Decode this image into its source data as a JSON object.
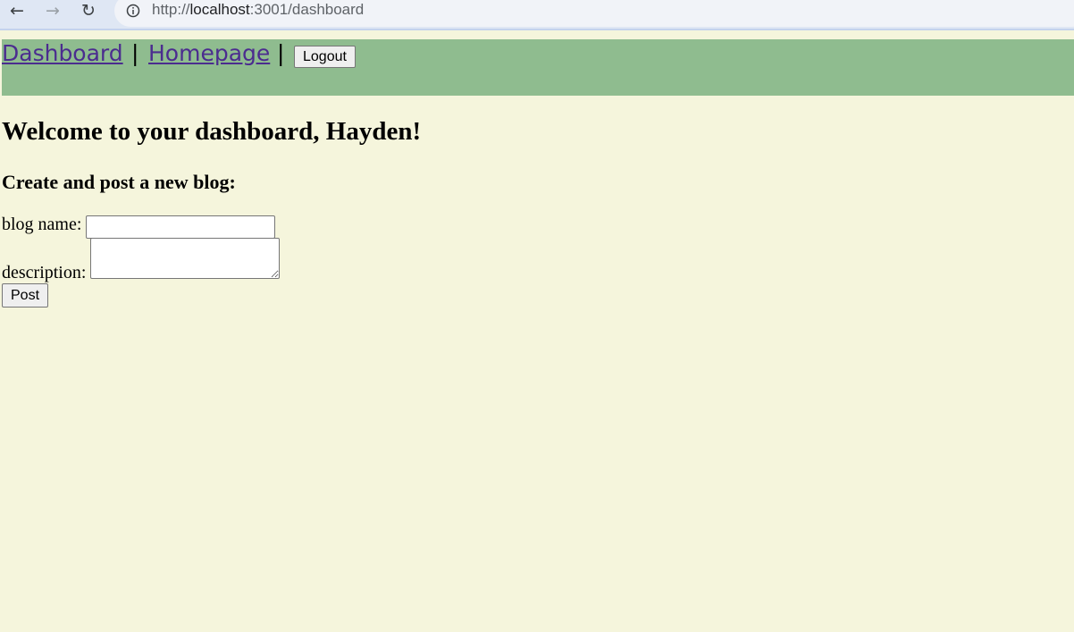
{
  "browser": {
    "url_scheme": "http://",
    "url_host": "localhost",
    "url_path": ":3001/dashboard",
    "icons": [
      "back-arrow-icon",
      "forward-arrow-icon",
      "reload-icon",
      "info-icon"
    ]
  },
  "header": {
    "links": [
      {
        "label": "Dashboard"
      },
      {
        "label": "Homepage"
      }
    ],
    "separator": "|",
    "logout_label": "Logout",
    "background_color": "#8fbc8f"
  },
  "main": {
    "title": "Welcome to your dashboard, Hayden!",
    "subtitle": "Create and post a new blog:",
    "form": {
      "name_label": "blog name:",
      "name_value": "",
      "description_label": "description:",
      "description_value": "",
      "submit_label": "Post"
    },
    "background_color": "#f5f5dc"
  }
}
